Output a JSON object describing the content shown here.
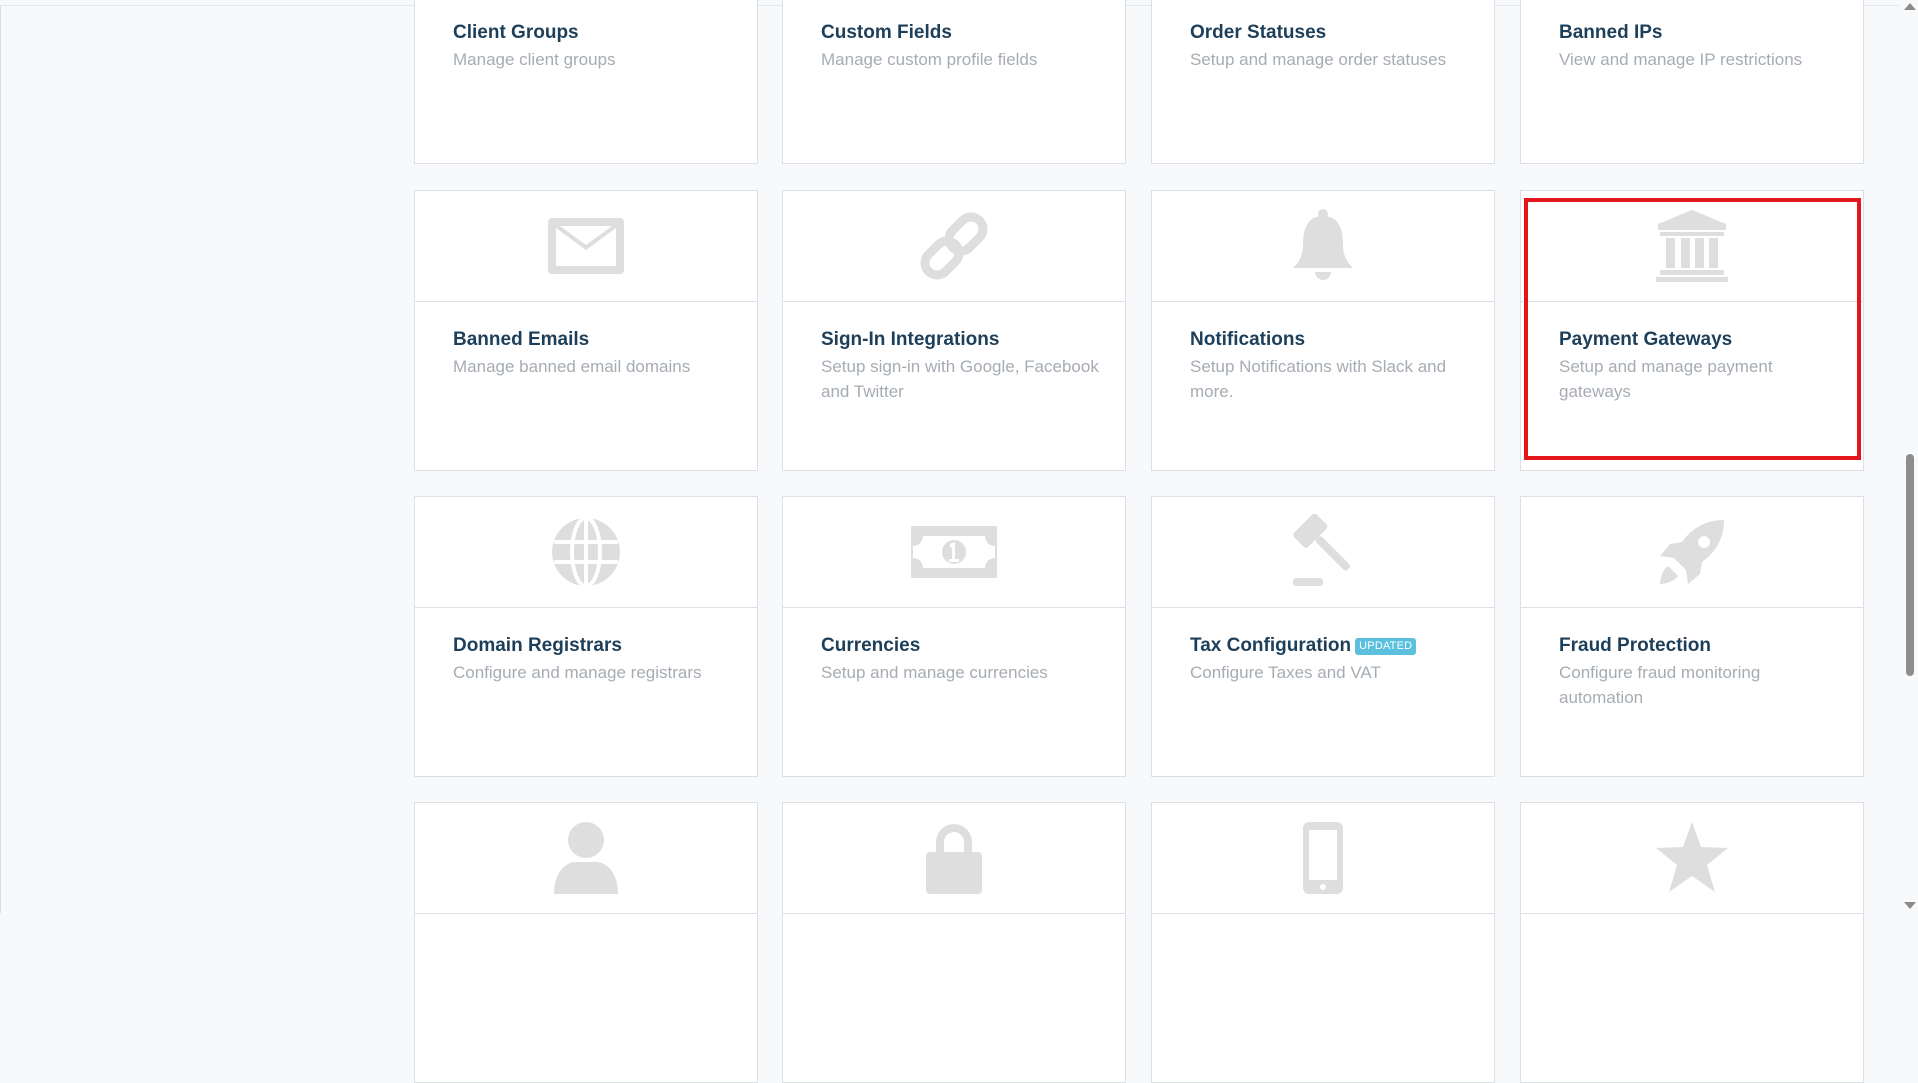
{
  "tiles": [
    {
      "title": "Client Groups",
      "desc": "Manage client groups"
    },
    {
      "title": "Custom Fields",
      "desc": "Manage custom profile fields"
    },
    {
      "title": "Order Statuses",
      "desc": "Setup and manage order statuses"
    },
    {
      "title": "Banned IPs",
      "desc": "View and manage IP restrictions"
    },
    {
      "title": "Banned Emails",
      "desc": "Manage banned email domains",
      "icon": "envelope-icon"
    },
    {
      "title": "Sign-In Integrations",
      "desc": "Setup sign-in with Google, Facebook and Twitter",
      "icon": "link-icon"
    },
    {
      "title": "Notifications",
      "desc": "Setup Notifications with Slack and more.",
      "icon": "bell-icon"
    },
    {
      "title": "Payment Gateways",
      "desc": "Setup and manage payment gateways",
      "icon": "bank-icon"
    },
    {
      "title": "Domain Registrars",
      "desc": "Configure and manage registrars",
      "icon": "globe-icon"
    },
    {
      "title": "Currencies",
      "desc": "Setup and manage currencies",
      "icon": "money-bill-icon"
    },
    {
      "title": "Tax Configuration",
      "badge": "UPDATED",
      "desc": "Configure Taxes and VAT",
      "icon": "gavel-icon"
    },
    {
      "title": "Fraud Protection",
      "desc": "Configure fraud monitoring automation",
      "icon": "rocket-icon"
    }
  ],
  "bottom_icons": [
    "user-icon",
    "lock-icon",
    "mobile-icon",
    "star-icon"
  ],
  "colors": {
    "title": "#1e3f5a",
    "description": "#a6acb3",
    "icon": "#dedede",
    "badge": "#5bc0de",
    "highlight": "#e3161b"
  }
}
